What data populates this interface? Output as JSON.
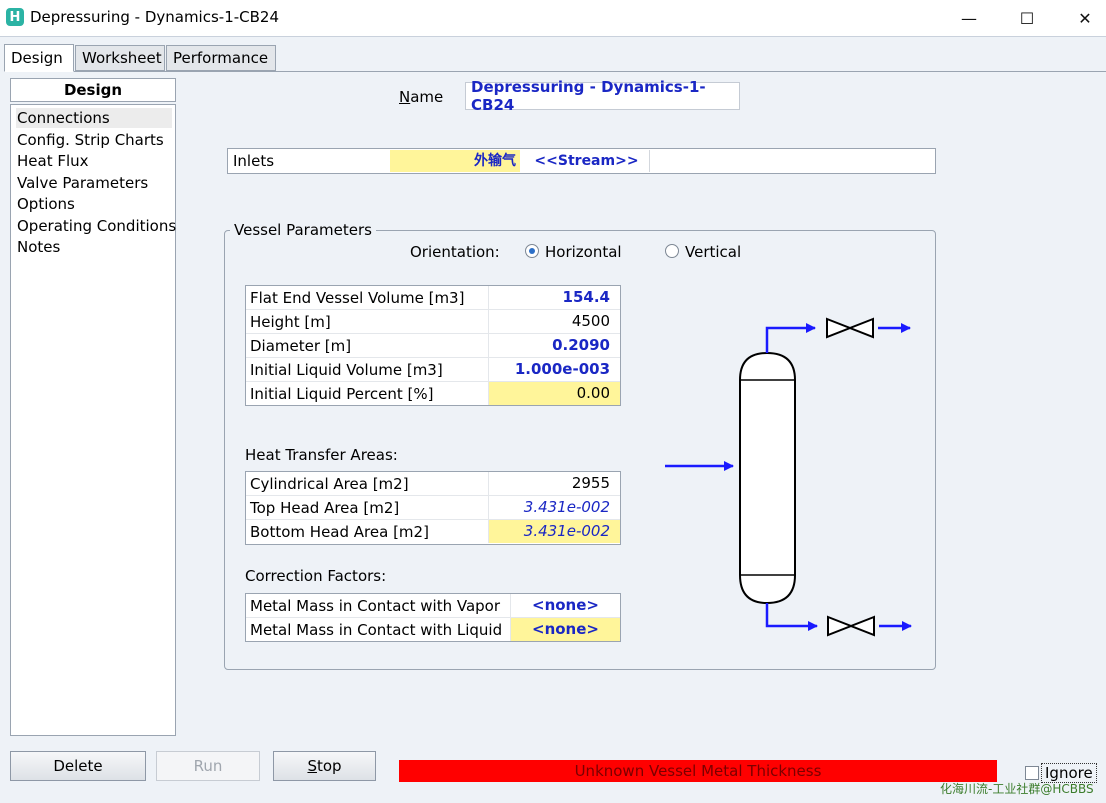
{
  "window": {
    "title": "Depressuring - Dynamics-1-CB24",
    "icon_letter": "H",
    "controls": {
      "minimize": "—",
      "maximize": "☐",
      "close": "✕"
    }
  },
  "tabs": [
    {
      "label": "Design",
      "active": true
    },
    {
      "label": "Worksheet",
      "active": false
    },
    {
      "label": "Performance",
      "active": false
    }
  ],
  "nav": {
    "header": "Design",
    "items": [
      {
        "label": "Connections",
        "selected": true
      },
      {
        "label": "Config. Strip Charts"
      },
      {
        "label": "Heat Flux"
      },
      {
        "label": "Valve Parameters"
      },
      {
        "label": "Options"
      },
      {
        "label": "Operating Conditions"
      },
      {
        "label": "Notes"
      }
    ]
  },
  "name": {
    "label": "Name",
    "label_hotkey": "N",
    "label_rest": "ame",
    "value": "Depressuring - Dynamics-1-CB24"
  },
  "inlets": {
    "label": "Inlets",
    "stream": "外输气",
    "new_stream": "<<Stream>>"
  },
  "vessel": {
    "group_label": "Vessel Parameters",
    "orientation_label": "Orientation:",
    "orientation_options": [
      "Horizontal",
      "Vertical"
    ],
    "orientation_selected": "Horizontal",
    "geometry": [
      {
        "label": "Flat End Vessel Volume [m3]",
        "value": "154.4"
      },
      {
        "label": "Height [m]",
        "value": "4500"
      },
      {
        "label": "Diameter [m]",
        "value": "0.2090"
      },
      {
        "label": "Initial Liquid Volume [m3]",
        "value": "1.000e-003"
      },
      {
        "label": "Initial Liquid Percent [%]",
        "value": "0.00"
      }
    ],
    "heat_transfer_title": "Heat Transfer Areas:",
    "heat_transfer": [
      {
        "label": "Cylindrical Area [m2]",
        "value": "2955"
      },
      {
        "label": "Top Head Area [m2]",
        "value": "3.431e-002"
      },
      {
        "label": "Bottom Head Area [m2]",
        "value": "3.431e-002"
      }
    ],
    "correction_title": "Correction Factors:",
    "correction": [
      {
        "label": "Metal Mass in Contact with Vapor",
        "value": "<none>"
      },
      {
        "label": "Metal Mass in Contact with Liquid",
        "value": "<none>"
      }
    ]
  },
  "colors": {
    "accent_blue": "#1a27c4",
    "highlight_yellow": "#fff59a",
    "status_red": "#ff0000",
    "diagram_arrow": "#1a1aff"
  },
  "bottom": {
    "delete_label": "Delete",
    "run_label": "Run",
    "stop_label": "Stop",
    "stop_hotkey": "S",
    "stop_rest": "top",
    "status_message": "Unknown Vessel Metal Thickness",
    "ignore_label": "Ignore",
    "ignore_checked": false,
    "watermark": "化海川流-工业社群@HCBBS"
  }
}
